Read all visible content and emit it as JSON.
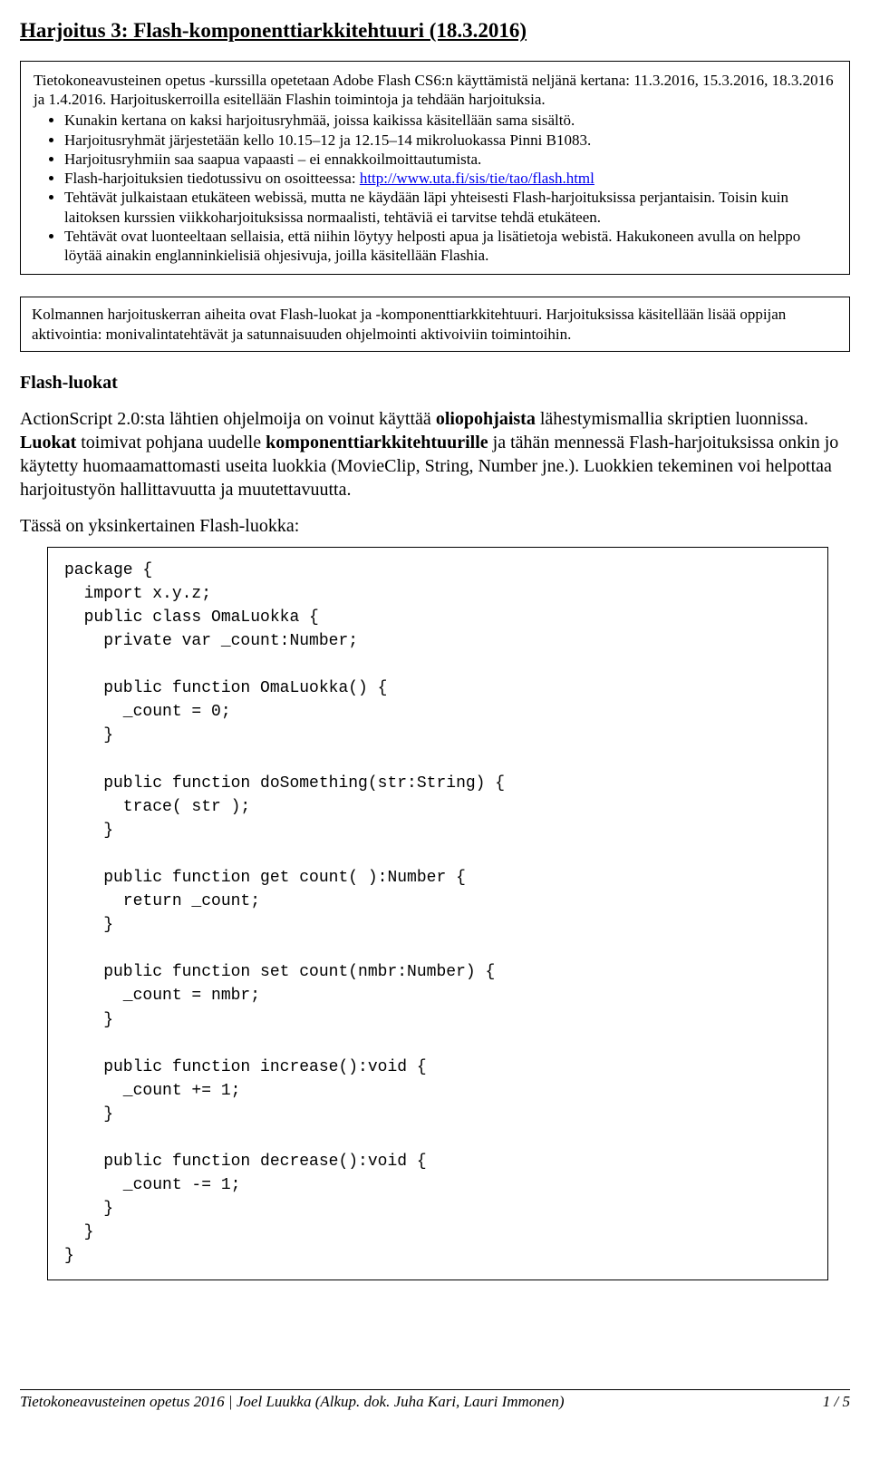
{
  "title": "Harjoitus 3: Flash-komponenttiarkkitehtuuri (18.3.2016)",
  "intro_paragraph": "Tietokoneavusteinen opetus -kurssilla opetetaan Adobe Flash CS6:n käyttämistä neljänä kertana: 11.3.2016, 15.3.2016, 18.3.2016 ja 1.4.2016. Harjoituskerroilla esitellään Flashin toimintoja ja tehdään harjoituksia.",
  "bullets": {
    "b1": "Kunakin kertana on kaksi harjoitusryhmää, joissa kaikissa käsitellään sama sisältö.",
    "b2": "Harjoitusryhmät järjestetään kello 10.15–12 ja 12.15–14 mikroluokassa Pinni B1083.",
    "b3": "Harjoitusryhmiin saa saapua vapaasti – ei ennakkoilmoittautumista.",
    "b4a": "Flash-harjoituksien tiedotussivu on osoitteessa: ",
    "b4link": "http://www.uta.fi/sis/tie/tao/flash.html",
    "b5": "Tehtävät julkaistaan etukäteen webissä, mutta ne käydään läpi yhteisesti Flash-harjoituksissa perjantaisin. Toisin kuin laitoksen kurssien viikkoharjoituksissa normaalisti, tehtäviä ei tarvitse tehdä etukäteen.",
    "b6": "Tehtävät ovat luonteeltaan sellaisia, että niihin löytyy helposti apua ja lisätietoja webistä.   Hakukoneen avulla on helppo löytää ainakin englanninkielisiä ohjesivuja, joilla käsitellään Flashia."
  },
  "summary": "Kolmannen harjoituskerran aiheita ovat Flash-luokat ja -komponenttiarkkitehtuuri. Harjoituksissa käsitellään lisää oppijan aktivointia: monivalintatehtävät ja satunnaisuuden ohjelmointi aktivoiviin toimintoihin.",
  "section_heading": "Flash-luokat",
  "para1_parts": {
    "t1": "ActionScript 2.0:sta lähtien ohjelmoija on voinut käyttää ",
    "b1": "oliopohjaista",
    "t2": " lähestymismallia skriptien luonnissa. ",
    "b2": "Luokat",
    "t3": " toimivat pohjana uudelle ",
    "b3": "komponenttiarkkitehtuurille",
    "t4": " ja tähän mennessä Flash-harjoituksissa onkin jo käytetty huomaamattomasti useita luokkia (MovieClip, String, Number jne.). Luokkien tekeminen voi helpottaa harjoitustyön hallit­tavuutta ja muutettavuutta."
  },
  "para2": "Tässä on yksinkertainen Flash-luokka:",
  "code": "package {\n  import x.y.z;\n  public class OmaLuokka {\n    private var _count:Number;\n\n    public function OmaLuokka() {\n      _count = 0;\n    }\n\n    public function doSomething(str:String) {\n      trace( str );\n    }\n\n    public function get count( ):Number {\n      return _count;\n    }\n\n    public function set count(nmbr:Number) {\n      _count = nmbr;\n    }\n\n    public function increase():void {\n      _count += 1;\n    }\n\n    public function decrease():void {\n      _count -= 1;\n    }\n  }\n}",
  "footer_left": "Tietokoneavusteinen opetus 2016 | Joel Luukka (Alkup. dok. Juha Kari, Lauri Immonen)",
  "footer_right": "1 / 5"
}
